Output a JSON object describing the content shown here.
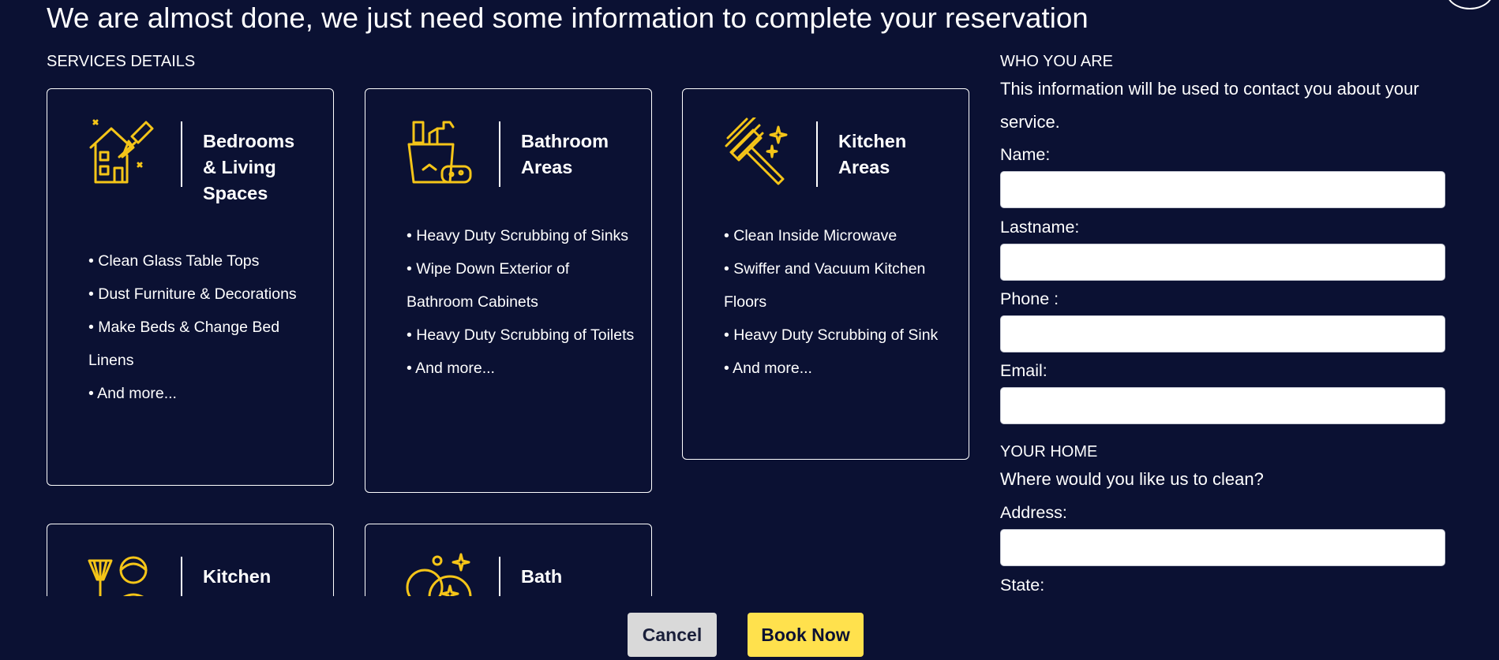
{
  "header": {
    "title": "We are almost done, we just need some information to complete your reservation"
  },
  "services": {
    "section_label": "SERVICES DETAILS",
    "cards": [
      {
        "icon": "house-broom-icon",
        "title": "Bedrooms & Living Spaces",
        "items": [
          "• Clean Glass Table Tops",
          "• Dust Furniture & Decorations",
          "• Make Beds & Change Bed Linens",
          "• And more..."
        ]
      },
      {
        "icon": "cleaning-supplies-icon",
        "title": "Bathroom Areas",
        "items": [
          "• Heavy Duty Scrubbing of Sinks",
          "• Wipe Down Exterior of Bathroom Cabinets",
          "• Heavy Duty Scrubbing of Toilets",
          "• And more..."
        ]
      },
      {
        "icon": "squeegee-icon",
        "title": "Kitchen Areas",
        "items": [
          "• Clean Inside Microwave",
          "• Swiffer and Vacuum Kitchen Floors",
          "• Heavy Duty Scrubbing of Sink",
          "• And more..."
        ]
      },
      {
        "icon": "maid-duster-icon",
        "title": "Kitchen",
        "items": []
      },
      {
        "icon": "sparkling-bubbles-icon",
        "title": "Bath",
        "items": []
      }
    ]
  },
  "contact": {
    "section_label": "WHO YOU ARE",
    "intro": "This information will be used to contact you about your service.",
    "fields": {
      "name": {
        "label": "Name:",
        "value": ""
      },
      "lastname": {
        "label": "Lastname:",
        "value": ""
      },
      "phone": {
        "label": "Phone :",
        "value": ""
      },
      "email": {
        "label": "Email:",
        "value": ""
      }
    }
  },
  "home": {
    "section_label": "YOUR HOME",
    "intro": "Where would you like us to clean?",
    "fields": {
      "address": {
        "label": "Address:",
        "value": ""
      },
      "state": {
        "label": "State:"
      }
    }
  },
  "actions": {
    "cancel_label": "Cancel",
    "book_label": "Book Now"
  },
  "colors": {
    "background": "#0b1133",
    "accent_yellow": "#ffe14d",
    "icon_yellow": "#f5c518",
    "cancel_gray": "#d9d9d9"
  }
}
